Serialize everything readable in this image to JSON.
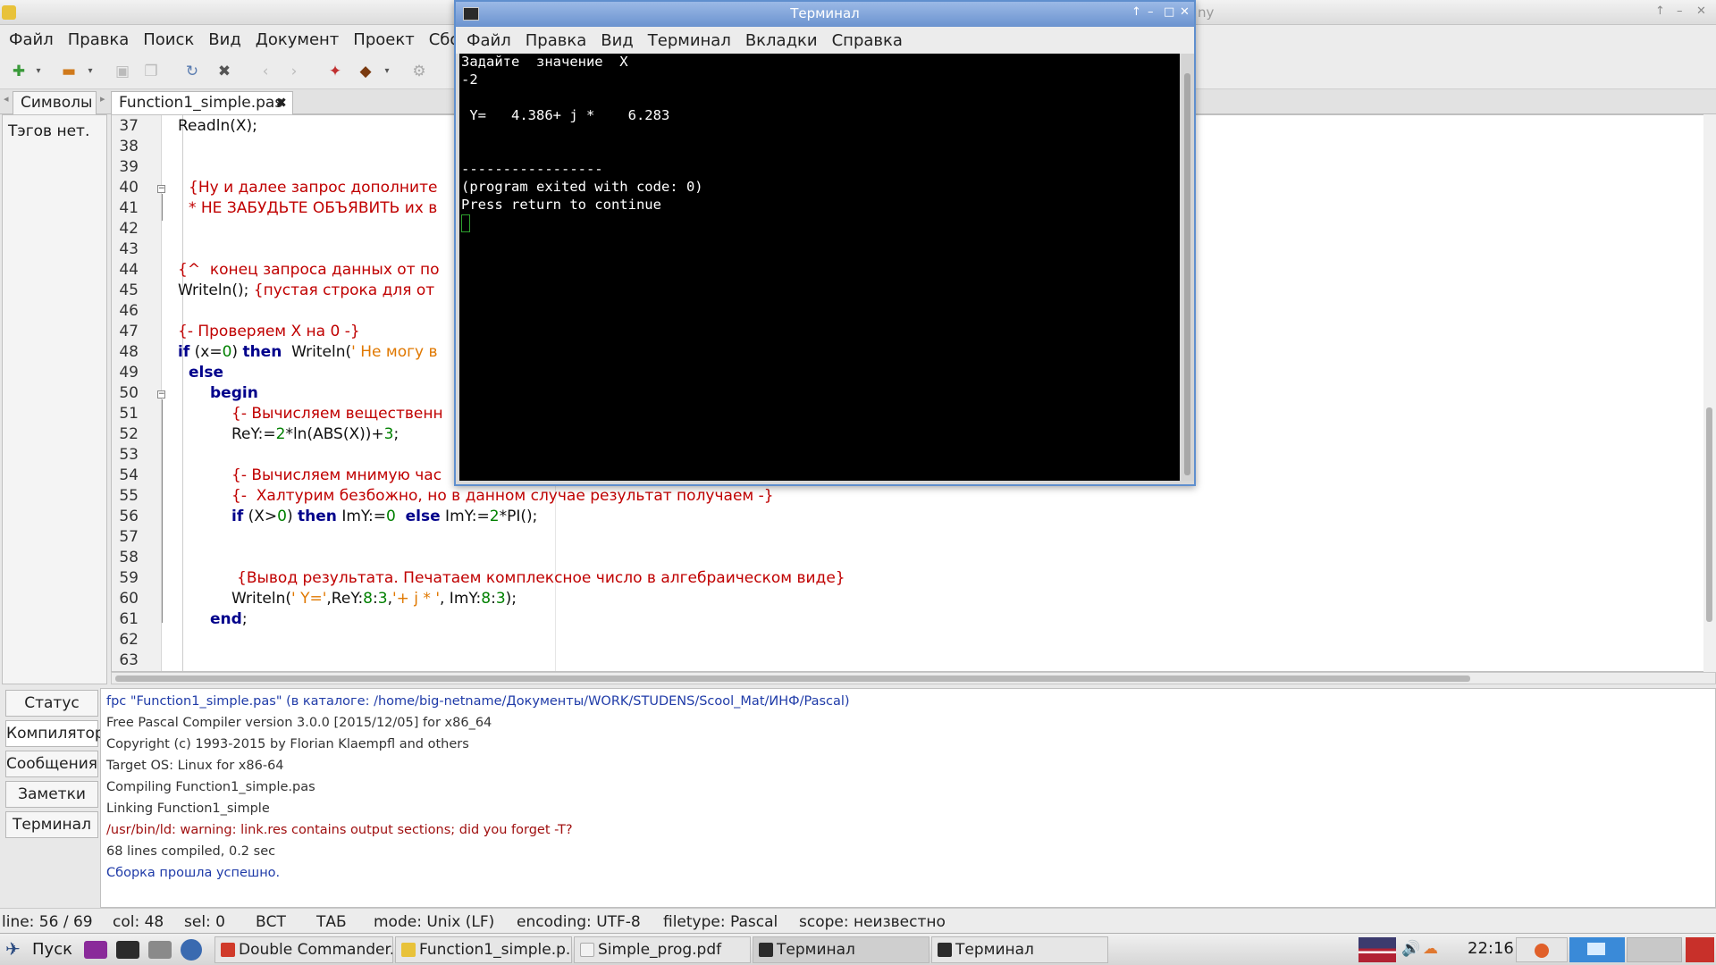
{
  "app": {
    "title_fragment": "ny",
    "window_controls": [
      "↑",
      "–",
      "✕"
    ]
  },
  "menu": [
    "Файл",
    "Правка",
    "Поиск",
    "Вид",
    "Документ",
    "Проект",
    "Сборка"
  ],
  "tabs": {
    "symbols": "Символы",
    "file": "Function1_simple.pas",
    "close": "✖"
  },
  "sidebar": {
    "text": "Тэгов нет."
  },
  "editor": {
    "lines": [
      {
        "n": "37",
        "code": "Readln(X);"
      },
      {
        "n": "38",
        "code": ""
      },
      {
        "n": "39",
        "code": ""
      },
      {
        "n": "40",
        "code": "{Ну и далее запрос дополните"
      },
      {
        "n": "41",
        "code": "* НЕ ЗАБУДЬТЕ ОБЪЯВИТЬ их в"
      },
      {
        "n": "42",
        "code": ""
      },
      {
        "n": "43",
        "code": ""
      },
      {
        "n": "44",
        "code": "{^  конец запроса данных от по"
      },
      {
        "n": "45",
        "pre": "Writeln(); ",
        "comment": "{пустая строка для от"
      },
      {
        "n": "46",
        "code": ""
      },
      {
        "n": "47",
        "code": "{- Проверяем X на 0 -}"
      },
      {
        "n": "48",
        "if": "if",
        "cond": " (x=",
        "zero": "0",
        "close": ") ",
        "then": "then",
        "wl": "  Writeln(",
        "str": "' Не могу в"
      },
      {
        "n": "49",
        "code": "else"
      },
      {
        "n": "50",
        "code": "begin"
      },
      {
        "n": "51",
        "code": "{- Вычисляем вещественн"
      },
      {
        "n": "52",
        "a": "ReY:=",
        "b": "2",
        "c": "*ln(ABS(X))+",
        "d": "3",
        "e": ";"
      },
      {
        "n": "53",
        "code": ""
      },
      {
        "n": "54",
        "code": "{- Вычисляем мнимую час"
      },
      {
        "n": "55",
        "code": "{-  Халтурим безбожно, но в данном случае результат получаем -}"
      },
      {
        "n": "56",
        "if": "if",
        "a": " (X>",
        "zero": "0",
        "b": ") ",
        "then": "then",
        "c": " ImY:=",
        "zero2": "0",
        "d": "  ",
        "else": "else",
        "e": " ImY:=",
        "two": "2",
        "f": "*PI();"
      },
      {
        "n": "57",
        "code": ""
      },
      {
        "n": "58",
        "code": ""
      },
      {
        "n": "59",
        "code": "{Вывод результата. Печатаем комплексное число в алгебраическом виде}"
      },
      {
        "n": "60",
        "a": "Writeln(",
        "s1": "' Y='",
        "b": ",ReY:",
        "n1": "8",
        "c": ":",
        "n2": "3",
        "d": ",",
        "s2": "'+ j * '",
        "e": ", ImY:",
        "n3": "8",
        "f": ":",
        "n4": "3",
        "g": ");"
      },
      {
        "n": "61",
        "kw": "end",
        "tail": ";"
      },
      {
        "n": "62",
        "code": ""
      },
      {
        "n": "63",
        "code": ""
      }
    ]
  },
  "bottom_tabs": [
    "Статус",
    "Компилятор",
    "Сообщения",
    "Заметки",
    "Терминал"
  ],
  "log": [
    {
      "text": "fpc \"Function1_simple.pas\" (в каталоге: /home/big-netname/Документы/WORK/STUDENS/Scool_Mat/ИНФ/Pascal)",
      "kind": "blue"
    },
    {
      "text": "Free Pascal Compiler version 3.0.0 [2015/12/05] for x86_64",
      "kind": "normal"
    },
    {
      "text": "Copyright (c) 1993-2015 by Florian Klaempfl and others",
      "kind": "normal"
    },
    {
      "text": "Target OS: Linux for x86-64",
      "kind": "normal"
    },
    {
      "text": "Compiling Function1_simple.pas",
      "kind": "normal"
    },
    {
      "text": "Linking Function1_simple",
      "kind": "normal"
    },
    {
      "text": "/usr/bin/ld: warning: link.res contains output sections; did you forget -T?",
      "kind": "red"
    },
    {
      "text": "68 lines compiled, 0.2 sec",
      "kind": "normal"
    },
    {
      "text": "Сборка прошла успешно.",
      "kind": "blue"
    }
  ],
  "status": {
    "line": "line: 56 / 69",
    "col": "col: 48",
    "sel": "sel: 0",
    "ins": "ВСТ",
    "tab": "ТАБ",
    "mode": "mode: Unix (LF)",
    "encoding": "encoding: UTF-8",
    "filetype": "filetype: Pascal",
    "scope": "scope: неизвестно"
  },
  "terminal": {
    "title": "Терминал",
    "controls": [
      "↑",
      "–",
      "□",
      "✕"
    ],
    "menu": [
      "Файл",
      "Правка",
      "Вид",
      "Терминал",
      "Вкладки",
      "Справка"
    ],
    "output": [
      "Задайте  значение  X",
      "-2",
      "",
      " Y=   4.386+ j *    6.283",
      "",
      "",
      "-----------------",
      "(program exited with code: 0)",
      "Press return to continue"
    ]
  },
  "taskbar": {
    "start": "Пуск",
    "tasks": [
      "Double Commander...",
      "Function1_simple.p...",
      "Simple_prog.pdf",
      "Терминал",
      "Терминал"
    ],
    "clock": "22:16"
  }
}
